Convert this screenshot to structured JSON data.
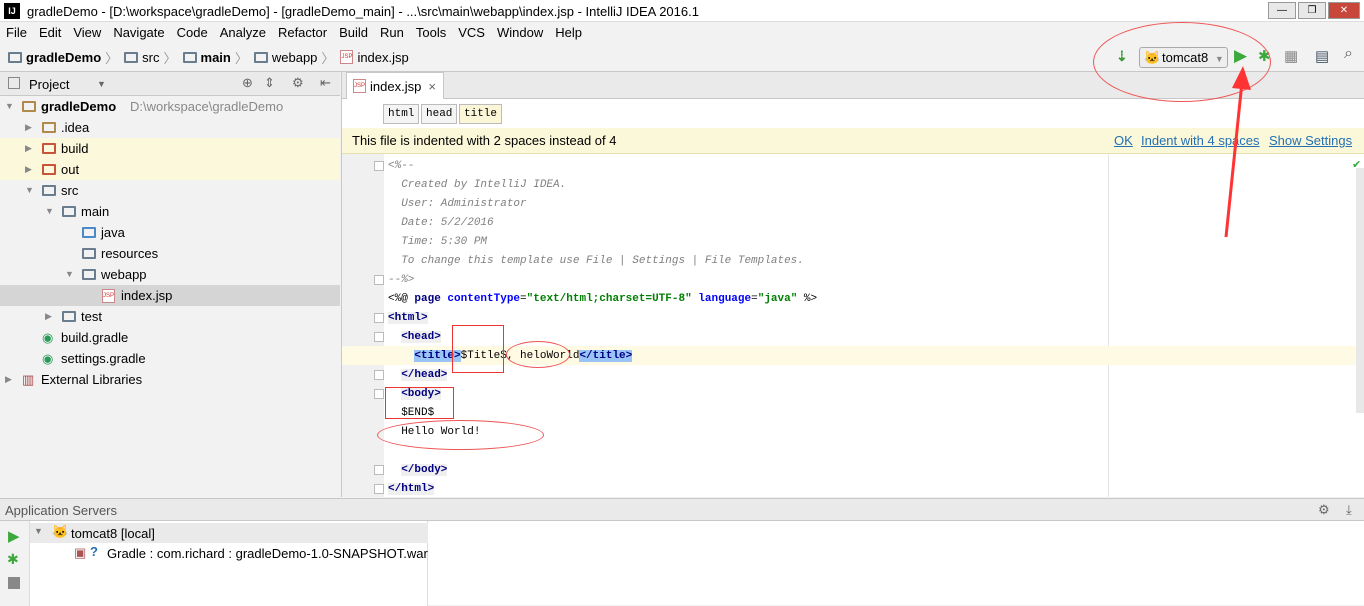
{
  "window": {
    "title": "gradleDemo - [D:\\workspace\\gradleDemo] - [gradleDemo_main] - ...\\src\\main\\webapp\\index.jsp - IntelliJ IDEA 2016.1",
    "app_icon": "IJ"
  },
  "menu": [
    "File",
    "Edit",
    "View",
    "Navigate",
    "Code",
    "Analyze",
    "Refactor",
    "Build",
    "Run",
    "Tools",
    "VCS",
    "Window",
    "Help"
  ],
  "breadcrumb": [
    "gradleDemo",
    "src",
    "main",
    "webapp",
    "index.jsp"
  ],
  "toolbar": {
    "run_config": "tomcat8",
    "icons": [
      "make-icon",
      "tomcat-icon",
      "run-icon",
      "debug-icon",
      "coverage-icon",
      "project-structure-icon",
      "search-icon"
    ]
  },
  "project_panel": {
    "title": "Project",
    "tree": [
      {
        "label": "gradleDemo",
        "extra": "D:\\workspace\\gradleDemo",
        "depth": 0,
        "expanded": true,
        "bold": true
      },
      {
        "label": ".idea",
        "depth": 1,
        "expanded": false
      },
      {
        "label": "build",
        "depth": 1,
        "expanded": false,
        "highlight": true
      },
      {
        "label": "out",
        "depth": 1,
        "expanded": false,
        "highlight": true
      },
      {
        "label": "src",
        "depth": 1,
        "expanded": true
      },
      {
        "label": "main",
        "depth": 2,
        "expanded": true
      },
      {
        "label": "java",
        "depth": 3
      },
      {
        "label": "resources",
        "depth": 3
      },
      {
        "label": "webapp",
        "depth": 3,
        "expanded": true
      },
      {
        "label": "index.jsp",
        "depth": 4,
        "selected": true,
        "file": true
      },
      {
        "label": "test",
        "depth": 2,
        "expanded": false
      },
      {
        "label": "build.gradle",
        "depth": 1,
        "gradle": true
      },
      {
        "label": "settings.gradle",
        "depth": 1,
        "gradle": true
      },
      {
        "label": "External Libraries",
        "depth": 0,
        "expanded": false,
        "lib": true
      }
    ]
  },
  "editor": {
    "tab": "index.jsp",
    "tags": [
      "html",
      "head",
      "title"
    ],
    "banner": {
      "message": "This file is indented with 2 spaces instead of 4",
      "ok": "OK",
      "indent": "Indent with 4 spaces",
      "settings": "Show Settings"
    },
    "lines": [
      [
        [
          "<%--",
          "cm"
        ]
      ],
      [
        [
          "  Created by IntelliJ IDEA.",
          "cm"
        ]
      ],
      [
        [
          "  User: Administrator",
          "cm"
        ]
      ],
      [
        [
          "  Date: 5/2/2016",
          "cm"
        ]
      ],
      [
        [
          "  Time: 5:30 PM",
          "cm"
        ]
      ],
      [
        [
          "  To change this template use File | Settings | File Templates.",
          "cm"
        ]
      ],
      [
        [
          "--%>",
          "cm"
        ]
      ],
      [
        [
          "<%@ ",
          "tx"
        ],
        [
          "page ",
          "kw"
        ],
        [
          "contentType",
          "at"
        ],
        [
          "=",
          "tx"
        ],
        [
          "\"text/html;charset=UTF-8\"",
          "st"
        ],
        [
          " ",
          "tx"
        ],
        [
          "language",
          "at"
        ],
        [
          "=",
          "tx"
        ],
        [
          "\"java\"",
          "st"
        ],
        [
          " %>",
          "tx"
        ]
      ],
      [
        [
          "<html>",
          "tg"
        ]
      ],
      [
        [
          "  ",
          "tx"
        ],
        [
          "<head>",
          "tg"
        ]
      ],
      [
        [
          "    ",
          "tx"
        ],
        [
          "<title>",
          "tgs"
        ],
        [
          "$Title$, heloWorld",
          "tx"
        ],
        [
          "</title>",
          "tgs"
        ]
      ],
      [
        [
          "  ",
          "tx"
        ],
        [
          "</head>",
          "tg"
        ]
      ],
      [
        [
          "  ",
          "tx"
        ],
        [
          "<body>",
          "tg"
        ]
      ],
      [
        [
          "  $END$",
          "tx"
        ]
      ],
      [
        [
          "  Hello World!",
          "tx"
        ]
      ],
      [
        [
          "",
          "tx"
        ]
      ],
      [
        [
          "  ",
          "tx"
        ],
        [
          "</body>",
          "tg"
        ]
      ],
      [
        [
          "</html>",
          "tg"
        ]
      ]
    ]
  },
  "bottom_panel": {
    "title": "Application Servers",
    "server": "tomcat8 [local]",
    "artifact": "Gradle : com.richard : gradleDemo-1.0-SNAPSHOT.war"
  },
  "colors": {
    "accent": "#2470b3",
    "annotation": "#e53333",
    "banner_bg": "#fbf8d9",
    "selection": "#99c4f5"
  }
}
